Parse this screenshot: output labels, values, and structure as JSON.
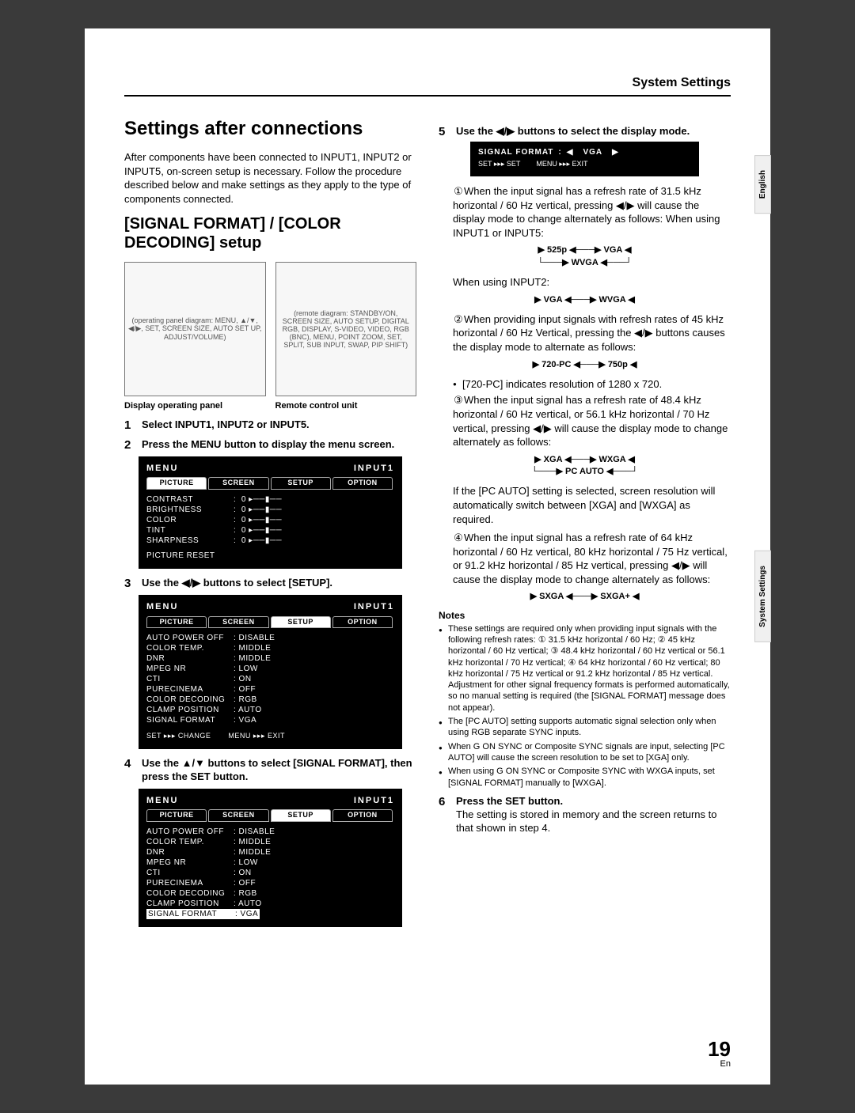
{
  "header": {
    "title": "System Settings"
  },
  "sideTabs": {
    "lang": "English",
    "section": "System Settings"
  },
  "left": {
    "h1": "Settings after connections",
    "intro": "After components have been connected to INPUT1, INPUT2 or INPUT5, on-screen setup is necessary. Follow the procedure described below and make settings as they apply to the type of components connected.",
    "h2": "[SIGNAL FORMAT] / [COLOR DECODING] setup",
    "diag1Hint": "(operating panel diagram: MENU, ▲/▼, ◀/▶, SET, SCREEN SIZE, AUTO SET UP, ADJUST/VOLUME)",
    "diag2Hint": "(remote diagram: STANDBY/ON, SCREEN SIZE, AUTO SETUP, DIGITAL RGB, DISPLAY, S-VIDEO, VIDEO, RGB (BNC), MENU, POINT ZOOM, SET, SPLIT, SUB INPUT, SWAP, PIP SHIFT)",
    "cap1": "Display operating panel",
    "cap2": "Remote control unit",
    "steps": {
      "s1": {
        "num": "1",
        "text": "Select INPUT1, INPUT2 or INPUT5."
      },
      "s2": {
        "num": "2",
        "text": "Press the MENU button to display the menu screen."
      },
      "s3": {
        "num": "3",
        "text": "Use the ◀/▶ buttons to select [SETUP]."
      },
      "s4": {
        "num": "4",
        "text": "Use the ▲/▼ buttons to select [SIGNAL FORMAT], then press the SET button."
      }
    },
    "osd1": {
      "menu": "MENU",
      "input": "INPUT1",
      "tabs": [
        "PICTURE",
        "SCREEN",
        "SETUP",
        "OPTION"
      ],
      "rows": [
        [
          "CONTRAST",
          ":",
          "slider"
        ],
        [
          "BRIGHTNESS",
          ":",
          "slider"
        ],
        [
          "COLOR",
          ":",
          "slider"
        ],
        [
          "TINT",
          ":",
          "slider"
        ],
        [
          "SHARPNESS",
          ":",
          "slider"
        ]
      ],
      "reset": "PICTURE RESET"
    },
    "osd2": {
      "menu": "MENU",
      "input": "INPUT1",
      "tabs": [
        "PICTURE",
        "SCREEN",
        "SETUP",
        "OPTION"
      ],
      "rows": [
        [
          "AUTO POWER OFF",
          ": DISABLE"
        ],
        [
          "COLOR TEMP.",
          ": MIDDLE"
        ],
        [
          "DNR",
          ": MIDDLE"
        ],
        [
          "MPEG NR",
          ": LOW"
        ],
        [
          "CTI",
          ": ON"
        ],
        [
          "PURECINEMA",
          ": OFF"
        ],
        [
          "COLOR DECODING",
          ": RGB"
        ],
        [
          "CLAMP POSITION",
          ": AUTO"
        ],
        [
          "SIGNAL FORMAT",
          ": VGA"
        ]
      ],
      "footL": "SET ▸▸▸ CHANGE",
      "footR": "MENU ▸▸▸ EXIT"
    },
    "osd3": {
      "menu": "MENU",
      "input": "INPUT1",
      "tabs": [
        "PICTURE",
        "SCREEN",
        "SETUP",
        "OPTION"
      ],
      "rows": [
        [
          "AUTO POWER OFF",
          ": DISABLE"
        ],
        [
          "COLOR TEMP.",
          ": MIDDLE"
        ],
        [
          "DNR",
          ": MIDDLE"
        ],
        [
          "MPEG NR",
          ": LOW"
        ],
        [
          "CTI",
          ": ON"
        ],
        [
          "PURECINEMA",
          ": OFF"
        ],
        [
          "COLOR DECODING",
          ": RGB"
        ],
        [
          "CLAMP POSITION",
          ": AUTO"
        ],
        [
          "SIGNAL FORMAT",
          ": VGA"
        ]
      ],
      "highlight": 8
    }
  },
  "right": {
    "s5": {
      "num": "5",
      "text": "Use the ◀/▶ buttons to select the display mode."
    },
    "osdSig": {
      "label": "SIGNAL FORMAT",
      "sep": ":",
      "left": "◀",
      "val": "VGA",
      "right": "▶",
      "footL": "SET ▸▸▸ SET",
      "footR": "MENU ▸▸▸ EXIT"
    },
    "p1a": "When the input signal has a refresh rate of 31.5 kHz horizontal / 60 Hz vertical, pressing ◀/▶ will cause the display mode to change alternately as follows: When using INPUT1 or INPUT5:",
    "flow1": "▶ 525p ◀───▶ VGA ◀\n└───▶ WVGA ◀───┘",
    "p1b": "When using INPUT2:",
    "flow1b": "▶ VGA ◀───▶ WVGA ◀",
    "p2": "When providing input signals with refresh rates of 45 kHz horizontal / 60 Hz Vertical, pressing the ◀/▶ buttons causes the display mode to alternate as follows:",
    "flow2": "▶ 720-PC ◀───▶ 750p ◀",
    "bullet720": "[720-PC] indicates resolution of 1280 x 720.",
    "p3": "When the input signal has a refresh rate of 48.4 kHz horizontal / 60 Hz vertical, or 56.1 kHz horizontal / 70 Hz vertical, pressing ◀/▶ will cause the display mode to change alternately as follows:",
    "flow3": "▶ XGA ◀───▶ WXGA ◀\n└───▶ PC AUTO ◀───┘",
    "p3b": "If the [PC AUTO] setting is selected, screen resolution will automatically switch between [XGA] and [WXGA] as required.",
    "p4": "When the input signal has a refresh rate of 64 kHz horizontal / 60 Hz vertical, 80 kHz horizontal / 75 Hz vertical, or 91.2 kHz horizontal / 85 Hz vertical, pressing ◀/▶ will cause the display mode to change alternately as follows:",
    "flow4": "▶ SXGA ◀───▶ SXGA+ ◀",
    "notesHead": "Notes",
    "notes": [
      "These settings are required only when providing input signals with the following refresh rates: ① 31.5 kHz horizontal / 60 Hz; ② 45 kHz horizontal / 60 Hz vertical; ③ 48.4 kHz horizontal / 60 Hz vertical or 56.1 kHz horizontal / 70 Hz vertical; ④ 64 kHz horizontal / 60 Hz vertical; 80 kHz horizontal / 75 Hz vertical  or 91.2 kHz horizontal / 85 Hz vertical. Adjustment for other signal frequency formats is performed automatically, so no manual setting is required (the [SIGNAL FORMAT] message does not appear).",
      "The [PC AUTO] setting supports automatic signal selection only when using RGB separate SYNC inputs.",
      "When G ON SYNC or Composite SYNC signals are input, selecting [PC AUTO] will cause the screen resolution to be set to [XGA] only.",
      "When using G ON SYNC or Composite SYNC with WXGA inputs, set [SIGNAL FORMAT] manually to [WXGA]."
    ],
    "s6": {
      "num": "6",
      "text": "Press the SET button.",
      "after": "The setting is stored in memory and the screen returns to that shown in step 4."
    }
  },
  "pageNum": {
    "n": "19",
    "lang": "En"
  }
}
